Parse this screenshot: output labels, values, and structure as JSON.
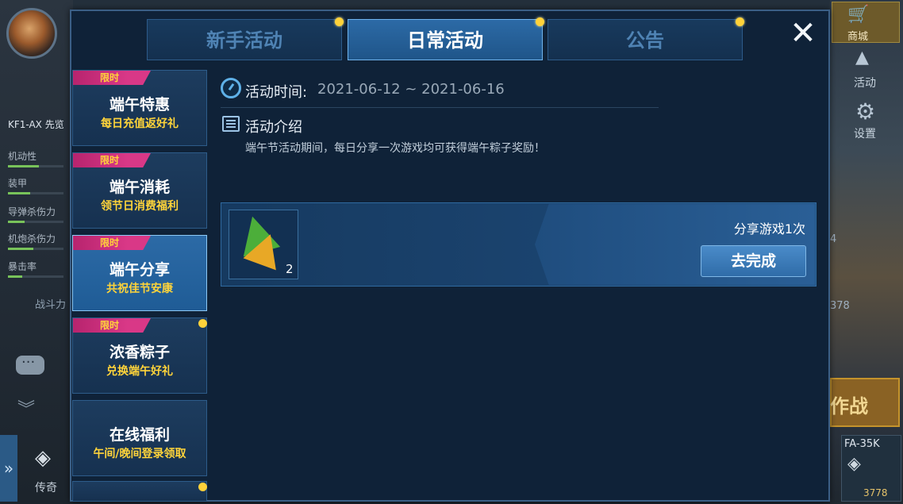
{
  "background": {
    "craft_name": "KF1-AX 先览",
    "stats": [
      "机动性",
      "装甲",
      "导弹杀伤力",
      "机炮杀伤力",
      "暴击率"
    ],
    "power_label": "战斗力",
    "legend_label": "传奇",
    "shop_label": "商城",
    "activity_label": "活动",
    "settings_label": "设置",
    "battle_label": "作战",
    "right_mid_number": "4",
    "right_power_number": "378",
    "craft_panel_name": "FA-35K",
    "craft_panel_power": "3778"
  },
  "tabs": [
    {
      "label": "新手活动",
      "active": false
    },
    {
      "label": "日常活动",
      "active": true
    },
    {
      "label": "公告",
      "active": false
    }
  ],
  "sidebar": [
    {
      "badge": "限时",
      "title": "端午特惠",
      "subtitle": "每日充值返好礼",
      "active": false,
      "dot": false
    },
    {
      "badge": "限时",
      "title": "端午消耗",
      "subtitle": "领节日消费福利",
      "active": false,
      "dot": false
    },
    {
      "badge": "限时",
      "title": "端午分享",
      "subtitle": "共祝佳节安康",
      "active": true,
      "dot": false
    },
    {
      "badge": "限时",
      "title": "浓香粽子",
      "subtitle": "兑换端午好礼",
      "active": false,
      "dot": true
    },
    {
      "badge": "",
      "title": "在线福利",
      "subtitle": "午间/晚间登录领取",
      "active": false,
      "dot": false
    }
  ],
  "detail": {
    "time_label": "活动时间:",
    "time_value": "2021-06-12 ~ 2021-06-16",
    "desc_label": "活动介绍",
    "desc_text": "端午节活动期间，每日分享一次游戏均可获得端午粽子奖励！"
  },
  "task": {
    "reward_count": "2",
    "description": "分享游戏1次",
    "button_label": "去完成"
  },
  "colors": {
    "accent_yellow": "#ffd43a",
    "badge_pink": "#d93887",
    "active_blue": "#2c6aa6"
  }
}
